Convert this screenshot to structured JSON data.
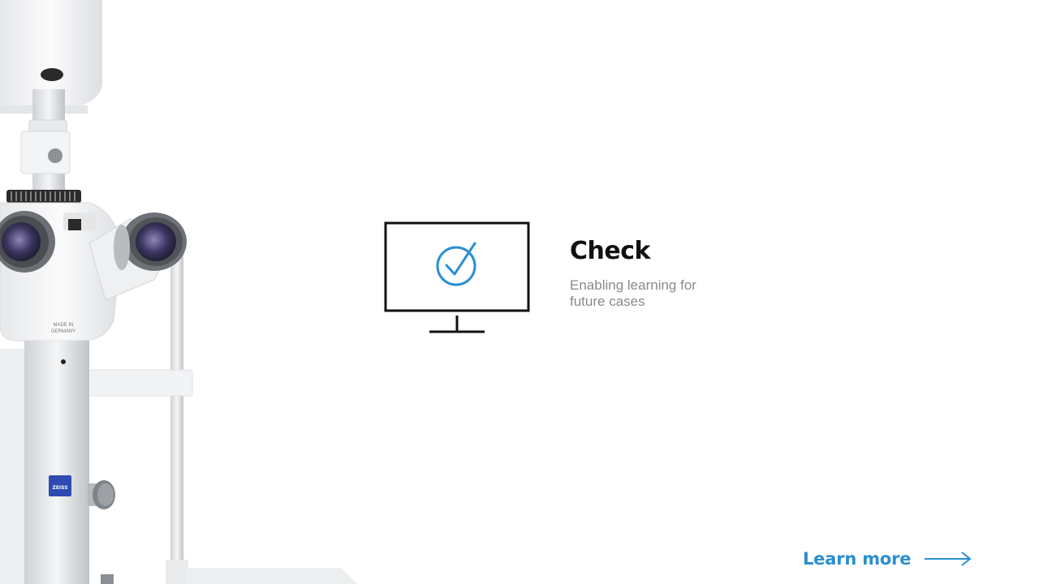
{
  "device": {
    "made_in_text": "MADE IN GERMANY",
    "brand_badge": "ZEISS"
  },
  "feature": {
    "title": "Check",
    "subtitle": "Enabling learning for future cases",
    "icon": "monitor-check-icon"
  },
  "cta": {
    "label": "Learn more",
    "icon": "arrow-right-icon"
  },
  "colors": {
    "accent": "#2a8fd0",
    "title": "#111111",
    "subtitle": "#8a8a8a",
    "badge": "#2d4bb0"
  }
}
